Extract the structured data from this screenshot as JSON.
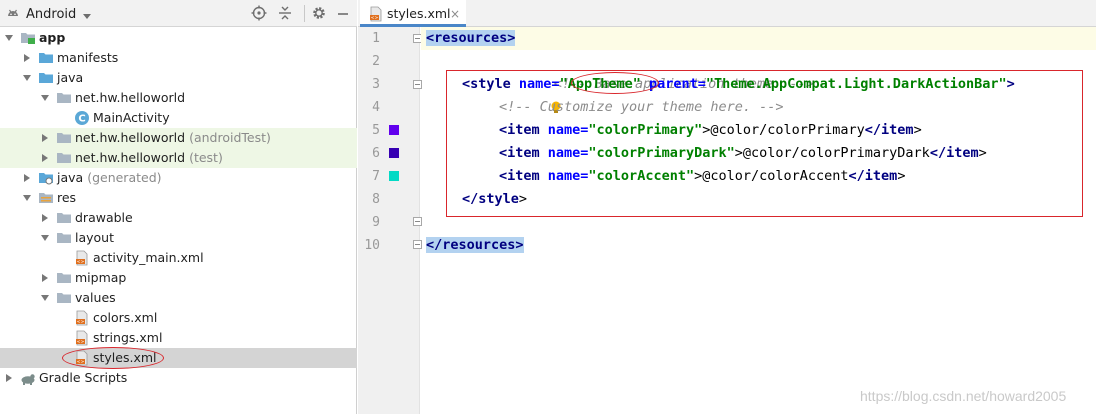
{
  "project_panel": {
    "view_selector": "Android",
    "tree": [
      {
        "label": "app",
        "bold": true
      },
      {
        "label": "manifests"
      },
      {
        "label": "java"
      },
      {
        "label": "net.hw.helloworld"
      },
      {
        "label": "MainActivity"
      },
      {
        "label": "net.hw.helloworld",
        "suffix": "(androidTest)"
      },
      {
        "label": "net.hw.helloworld",
        "suffix": "(test)"
      },
      {
        "label": "java",
        "suffix": "(generated)"
      },
      {
        "label": "res"
      },
      {
        "label": "drawable"
      },
      {
        "label": "layout"
      },
      {
        "label": "activity_main.xml"
      },
      {
        "label": "mipmap"
      },
      {
        "label": "values"
      },
      {
        "label": "colors.xml"
      },
      {
        "label": "strings.xml"
      },
      {
        "label": "styles.xml"
      },
      {
        "label": "Gradle Scripts"
      }
    ]
  },
  "editor": {
    "tab_label": "styles.xml",
    "tab_close": "×",
    "line_numbers": [
      "1",
      "2",
      "3",
      "4",
      "5",
      "6",
      "7",
      "8",
      "9",
      "10"
    ],
    "color_swatches": {
      "colorPrimary": "#6200ee",
      "colorPrimaryDark": "#3700b3",
      "colorAccent": "#03dac5"
    },
    "code": {
      "l1": {
        "open": "<resources>"
      },
      "l2": {
        "comment": "<!-- Base application theme. -->"
      },
      "l3": {
        "open": "<style",
        "name_attr": " name=",
        "name_val": "\"AppTheme\"",
        "parent_attr": " parent=",
        "parent_val": "\"Theme.AppCompat.Light.DarkActionBar\"",
        "close": ">"
      },
      "l4": {
        "comment": "<!-- Customize your theme here. -->"
      },
      "l5": {
        "open": "<item",
        "attr": " name=",
        "val": "\"colorPrimary\"",
        "gt": ">",
        "text": "@color/colorPrimary",
        "end": "</item",
        "end_gt": ">"
      },
      "l6": {
        "open": "<item",
        "attr": " name=",
        "val": "\"colorPrimaryDark\"",
        "gt": ">",
        "text": "@color/colorPrimaryDark",
        "end": "</item",
        "end_gt": ">"
      },
      "l7": {
        "open": "<item",
        "attr": " name=",
        "val": "\"colorAccent\"",
        "gt": ">",
        "text": "@color/colorAccent",
        "end": "</item",
        "end_gt": ">"
      },
      "l8": {
        "end": "</style",
        "end_gt": ">"
      },
      "l10": {
        "end": "</resources>"
      }
    }
  },
  "watermark": "https://blog.csdn.net/howard2005"
}
